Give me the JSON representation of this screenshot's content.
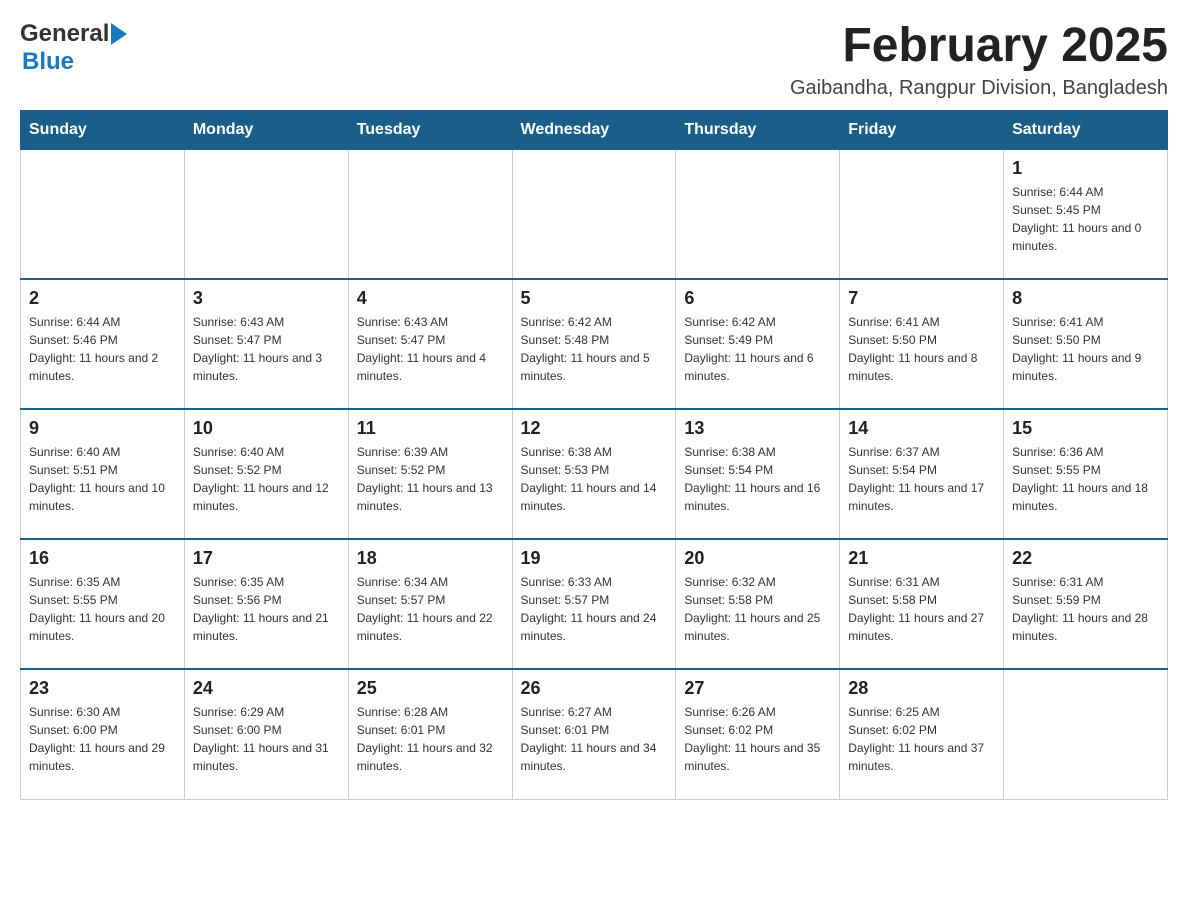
{
  "header": {
    "logo_general": "General",
    "logo_blue": "Blue",
    "month_title": "February 2025",
    "location": "Gaibandha, Rangpur Division, Bangladesh"
  },
  "days_of_week": [
    "Sunday",
    "Monday",
    "Tuesday",
    "Wednesday",
    "Thursday",
    "Friday",
    "Saturday"
  ],
  "weeks": [
    {
      "days": [
        {
          "date": "",
          "info": ""
        },
        {
          "date": "",
          "info": ""
        },
        {
          "date": "",
          "info": ""
        },
        {
          "date": "",
          "info": ""
        },
        {
          "date": "",
          "info": ""
        },
        {
          "date": "",
          "info": ""
        },
        {
          "date": "1",
          "info": "Sunrise: 6:44 AM\nSunset: 5:45 PM\nDaylight: 11 hours and 0 minutes."
        }
      ]
    },
    {
      "days": [
        {
          "date": "2",
          "info": "Sunrise: 6:44 AM\nSunset: 5:46 PM\nDaylight: 11 hours and 2 minutes."
        },
        {
          "date": "3",
          "info": "Sunrise: 6:43 AM\nSunset: 5:47 PM\nDaylight: 11 hours and 3 minutes."
        },
        {
          "date": "4",
          "info": "Sunrise: 6:43 AM\nSunset: 5:47 PM\nDaylight: 11 hours and 4 minutes."
        },
        {
          "date": "5",
          "info": "Sunrise: 6:42 AM\nSunset: 5:48 PM\nDaylight: 11 hours and 5 minutes."
        },
        {
          "date": "6",
          "info": "Sunrise: 6:42 AM\nSunset: 5:49 PM\nDaylight: 11 hours and 6 minutes."
        },
        {
          "date": "7",
          "info": "Sunrise: 6:41 AM\nSunset: 5:50 PM\nDaylight: 11 hours and 8 minutes."
        },
        {
          "date": "8",
          "info": "Sunrise: 6:41 AM\nSunset: 5:50 PM\nDaylight: 11 hours and 9 minutes."
        }
      ]
    },
    {
      "days": [
        {
          "date": "9",
          "info": "Sunrise: 6:40 AM\nSunset: 5:51 PM\nDaylight: 11 hours and 10 minutes."
        },
        {
          "date": "10",
          "info": "Sunrise: 6:40 AM\nSunset: 5:52 PM\nDaylight: 11 hours and 12 minutes."
        },
        {
          "date": "11",
          "info": "Sunrise: 6:39 AM\nSunset: 5:52 PM\nDaylight: 11 hours and 13 minutes."
        },
        {
          "date": "12",
          "info": "Sunrise: 6:38 AM\nSunset: 5:53 PM\nDaylight: 11 hours and 14 minutes."
        },
        {
          "date": "13",
          "info": "Sunrise: 6:38 AM\nSunset: 5:54 PM\nDaylight: 11 hours and 16 minutes."
        },
        {
          "date": "14",
          "info": "Sunrise: 6:37 AM\nSunset: 5:54 PM\nDaylight: 11 hours and 17 minutes."
        },
        {
          "date": "15",
          "info": "Sunrise: 6:36 AM\nSunset: 5:55 PM\nDaylight: 11 hours and 18 minutes."
        }
      ]
    },
    {
      "days": [
        {
          "date": "16",
          "info": "Sunrise: 6:35 AM\nSunset: 5:55 PM\nDaylight: 11 hours and 20 minutes."
        },
        {
          "date": "17",
          "info": "Sunrise: 6:35 AM\nSunset: 5:56 PM\nDaylight: 11 hours and 21 minutes."
        },
        {
          "date": "18",
          "info": "Sunrise: 6:34 AM\nSunset: 5:57 PM\nDaylight: 11 hours and 22 minutes."
        },
        {
          "date": "19",
          "info": "Sunrise: 6:33 AM\nSunset: 5:57 PM\nDaylight: 11 hours and 24 minutes."
        },
        {
          "date": "20",
          "info": "Sunrise: 6:32 AM\nSunset: 5:58 PM\nDaylight: 11 hours and 25 minutes."
        },
        {
          "date": "21",
          "info": "Sunrise: 6:31 AM\nSunset: 5:58 PM\nDaylight: 11 hours and 27 minutes."
        },
        {
          "date": "22",
          "info": "Sunrise: 6:31 AM\nSunset: 5:59 PM\nDaylight: 11 hours and 28 minutes."
        }
      ]
    },
    {
      "days": [
        {
          "date": "23",
          "info": "Sunrise: 6:30 AM\nSunset: 6:00 PM\nDaylight: 11 hours and 29 minutes."
        },
        {
          "date": "24",
          "info": "Sunrise: 6:29 AM\nSunset: 6:00 PM\nDaylight: 11 hours and 31 minutes."
        },
        {
          "date": "25",
          "info": "Sunrise: 6:28 AM\nSunset: 6:01 PM\nDaylight: 11 hours and 32 minutes."
        },
        {
          "date": "26",
          "info": "Sunrise: 6:27 AM\nSunset: 6:01 PM\nDaylight: 11 hours and 34 minutes."
        },
        {
          "date": "27",
          "info": "Sunrise: 6:26 AM\nSunset: 6:02 PM\nDaylight: 11 hours and 35 minutes."
        },
        {
          "date": "28",
          "info": "Sunrise: 6:25 AM\nSunset: 6:02 PM\nDaylight: 11 hours and 37 minutes."
        },
        {
          "date": "",
          "info": ""
        }
      ]
    }
  ]
}
